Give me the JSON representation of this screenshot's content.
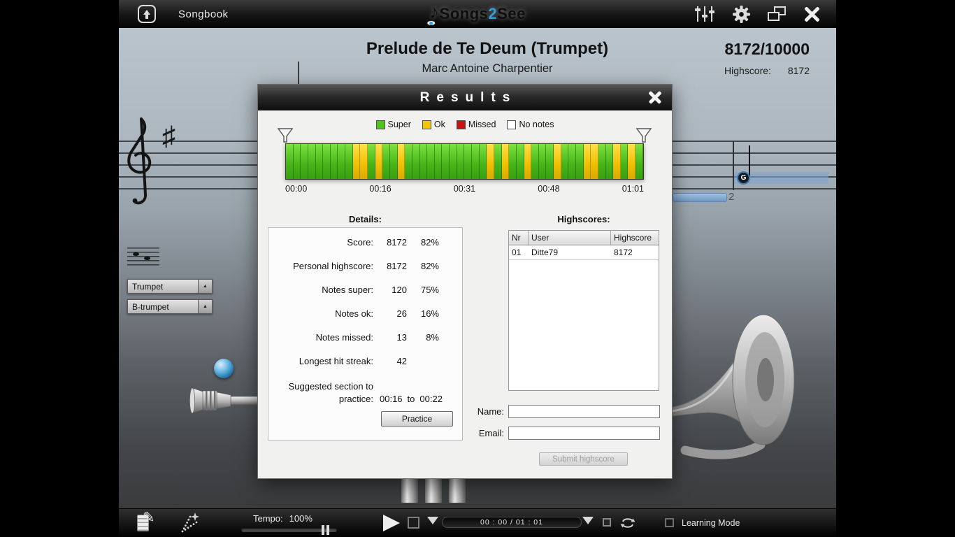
{
  "colors": {
    "super": "#4fc41e",
    "ok": "#f2c500",
    "missed": "#cc1111",
    "no_notes": "#ffffff",
    "accent": "#2e9fd4"
  },
  "icons": {
    "eighth_note": "♪",
    "pencil": "✎",
    "dropdown_arrow": "▲",
    "sharp": "♯"
  },
  "top_bar": {
    "songbook_label": "Songbook",
    "logo": {
      "part1": "Songs",
      "accent": "2",
      "part2": "See"
    }
  },
  "header": {
    "song_title": "Prelude de Te Deum (Trumpet)",
    "composer": "Marc Antoine Charpentier",
    "score": "8172/10000",
    "highscore_label": "Highscore:",
    "highscore_value": "8172"
  },
  "staff_area": {
    "instrument_select": "Trumpet",
    "tuning_select": "B-trumpet",
    "note_letter": "G",
    "measure_number": "2"
  },
  "results": {
    "title": "Results",
    "legend": [
      {
        "key": "super",
        "label": "Super"
      },
      {
        "key": "ok",
        "label": "Ok"
      },
      {
        "key": "missed",
        "label": "Missed"
      },
      {
        "key": "no_notes",
        "label": "No notes"
      }
    ],
    "timeline": {
      "segments": "gggggggggyygyggygggggggggggygyggygggygggyyggygyg",
      "ticks": [
        "00:00",
        "00:16",
        "00:31",
        "00:48",
        "01:01"
      ]
    },
    "details": {
      "heading": "Details:",
      "rows": [
        {
          "label": "Score:",
          "value": "8172",
          "pct": "82%"
        },
        {
          "label": "Personal highscore:",
          "value": "8172",
          "pct": "82%"
        },
        {
          "label": "Notes super:",
          "value": "120",
          "pct": "75%"
        },
        {
          "label": "Notes ok:",
          "value": "26",
          "pct": "16%"
        },
        {
          "label": "Notes missed:",
          "value": "13",
          "pct": "8%"
        },
        {
          "label": "Longest hit streak:",
          "value": "42",
          "pct": ""
        }
      ],
      "suggested": {
        "label": "Suggested section to practice:",
        "from": "00:16",
        "to_word": "to",
        "to": "00:22"
      },
      "practice_button": "Practice"
    },
    "highscores": {
      "heading": "Highscores:",
      "columns": [
        "Nr",
        "User",
        "Highscore"
      ],
      "rows": [
        [
          "01",
          "Ditte79",
          "8172"
        ]
      ]
    },
    "form": {
      "name_label": "Name:",
      "email_label": "Email:",
      "name_value": "",
      "email_value": "",
      "submit_label": "Submit highscore"
    }
  },
  "transport": {
    "tempo_label": "Tempo:",
    "tempo_value": "100%",
    "time_display": "00 : 00 / 01 : 01",
    "learning_mode_label": "Learning Mode"
  }
}
